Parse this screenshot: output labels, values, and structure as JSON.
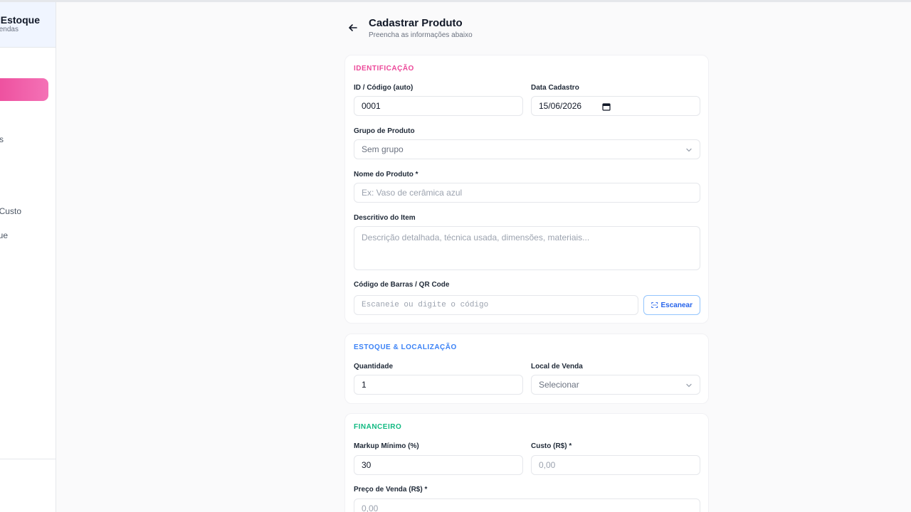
{
  "sidebar": {
    "brand_title": "e Estoque",
    "brand_sub": "endas",
    "items": [
      {
        "label": "s"
      },
      {
        "label": "Custo"
      },
      {
        "label": "ue"
      }
    ]
  },
  "header": {
    "title": "Cadastrar Produto",
    "subtitle": "Preencha as informações abaixo"
  },
  "identificacao": {
    "section_title": "IDENTIFICAÇÃO",
    "id_label": "ID / Código (auto)",
    "id_value": "0001",
    "date_label": "Data Cadastro",
    "date_value": "15/06/2026",
    "group_label": "Grupo de Produto",
    "group_value": "Sem grupo",
    "name_label": "Nome do Produto *",
    "name_placeholder": "Ex: Vaso de cerâmica azul",
    "desc_label": "Descritivo do Item",
    "desc_placeholder": "Descrição detalhada, técnica usada, dimensões, materiais...",
    "barcode_label": "Código de Barras / QR Code",
    "barcode_placeholder": "Escaneie ou digite o código",
    "scan_label": "Escanear"
  },
  "estoque": {
    "section_title": "ESTOQUE & LOCALIZAÇÃO",
    "qty_label": "Quantidade",
    "qty_value": "1",
    "local_label": "Local de Venda",
    "local_value": "Selecionar"
  },
  "financeiro": {
    "section_title": "FINANCEIRO",
    "markup_label": "Markup Mínimo (%)",
    "markup_value": "30",
    "cost_label": "Custo (R$) *",
    "cost_placeholder": "0,00",
    "price_label": "Preço de Venda (R$) *",
    "price_placeholder": "0,00"
  },
  "colors": {
    "accent_pink": "#ec4899",
    "accent_blue": "#3b82f6",
    "accent_green": "#10b981"
  }
}
